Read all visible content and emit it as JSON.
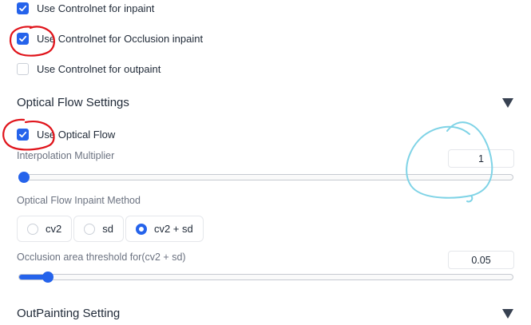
{
  "controlnet": {
    "inpaint_label": "Use Controlnet for inpaint",
    "inpaint_checked": true,
    "occlusion_label": "Use Controlnet for Occlusion inpaint",
    "occlusion_checked": true,
    "outpaint_label": "Use Controlnet for outpaint",
    "outpaint_checked": false
  },
  "optical_flow": {
    "section_title": "Optical Flow Settings",
    "use_label": "Use Optical Flow",
    "use_checked": true,
    "interp_label": "Interpolation Multiplier",
    "interp_value": "1",
    "interp_slider_fraction": 0.0,
    "method_label": "Optical Flow Inpaint Method",
    "method_options": [
      "cv2",
      "sd",
      "cv2 + sd"
    ],
    "method_selected": "cv2 + sd",
    "occlusion_label": "Occlusion area threshold for(cv2 + sd)",
    "occlusion_value": "0.05",
    "occlusion_slider_fraction": 0.05
  },
  "outpainting": {
    "section_title": "OutPainting Setting"
  },
  "colors": {
    "accent": "#2563eb",
    "annotation_red": "#e0141b",
    "annotation_cyan": "#7fd3e6"
  },
  "icons": {
    "checkmark": "check-icon",
    "collapse": "triangle-down-icon"
  }
}
